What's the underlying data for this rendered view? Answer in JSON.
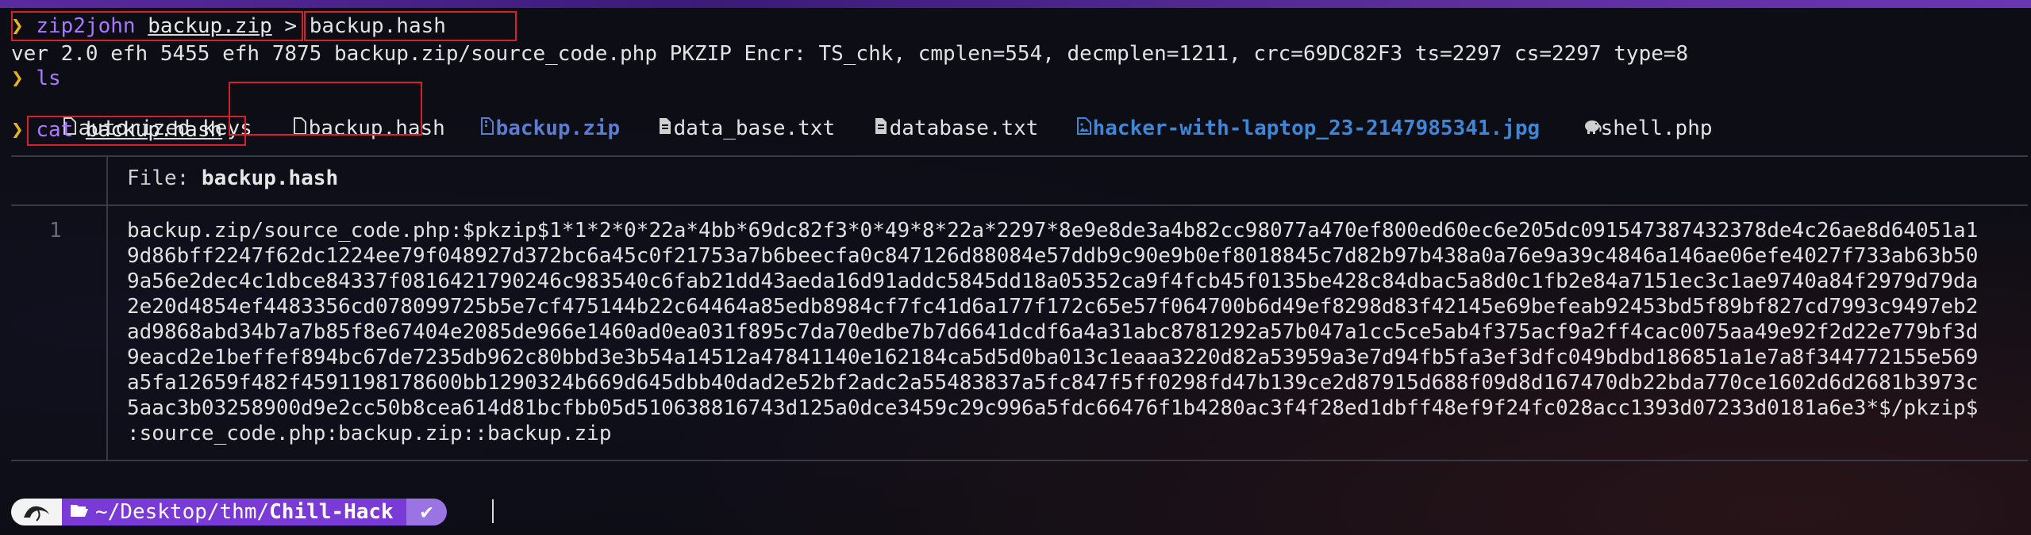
{
  "prompt_symbol": "❯",
  "line1": {
    "cmd": "zip2john",
    "arg": "backup.zip",
    "redirect": " > ",
    "out": "backup.hash"
  },
  "line2": {
    "text": "ver 2.0 efh 5455 efh 7875 backup.zip/source_code.php PKZIP Encr: TS_chk, cmplen=554, decmplen=1211, crc=69DC82F3 ts=2297 cs=2297 type=8"
  },
  "line3": {
    "cmd": "ls"
  },
  "ls_items": [
    {
      "name": "autorized_keys",
      "icon": "file-icon"
    },
    {
      "name": "backup.hash",
      "icon": "file-icon"
    },
    {
      "name": "backup.zip",
      "icon": "zip-icon"
    },
    {
      "name": "data_base.txt",
      "icon": "text-file-icon"
    },
    {
      "name": "database.txt",
      "icon": "text-file-icon"
    },
    {
      "name": "hacker-with-laptop_23-2147985341.jpg",
      "icon": "image-icon"
    },
    {
      "name": "shell.php",
      "icon": "php-elephant-icon"
    }
  ],
  "line4": {
    "cmd": "cat",
    "arg": "backup.hash"
  },
  "bat": {
    "file_label": "File: ",
    "file_name": "backup.hash",
    "line_number": "1",
    "lines": [
      "backup.zip/source_code.php:$pkzip$1*1*2*0*22a*4bb*69dc82f3*0*49*8*22a*2297*8e9e8de3a4b82cc98077a470ef800ed60ec6e205dc091547387432378de4c26ae8d64051a1",
      "9d86bff2247f62dc1224ee79f048927d372bc6a45c0f21753a7b6beecfa0c847126d88084e57ddb9c90e9b0ef8018845c7d82b97b438a0a76e9a39c4846a146ae06efe4027f733ab63b50",
      "9a56e2dec4c1dbce84337f0816421790246c983540c6fab21dd43aeda16d91addc5845dd18a05352ca9f4fcb45f0135be428c84dbac5a8d0c1fb2e84a7151ec3c1ae9740a84f2979d79da",
      "2e20d4854ef4483356cd078099725b5e7cf475144b22c64464a85edb8984cf7fc41d6a177f172c65e57f064700b6d49ef8298d83f42145e69befeab92453bd5f89bf827cd7993c9497eb2",
      "ad9868abd34b7a7b85f8e67404e2085de966e1460ad0ea031f895c7da70edbe7b7d6641dcdf6a4a31abc8781292a57b047a1cc5ce5ab4f375acf9a2ff4cac0075aa49e92f2d22e779bf3d",
      "9eacd2e1beffef894bc67de7235db962c80bbd3e3b54a14512a47841140e162184ca5d5d0ba013c1eaaa3220d82a53959a3e7d94fb5fa3ef3dfc049bdbd186851a1e7a8f344772155e569",
      "a5fa12659f482f4591198178600bb1290324b669d645dbb40dad2e52bf2adc2a55483837a5fc847f5ff0298fd47b139ce2d87915d688f09d8d167470db22bda770ce1602d6d2681b3973c",
      "5aac3b03258900d9e2cc50b8cea614d81bcfbb05d510638816743d125a0dce3459c29c996a5fdc66476f1b4280ac3f4f28ed1dbff48ef9f24fc028acc1393d07233d0181a6e3*$/pkzip$",
      ":source_code.php:backup.zip::backup.zip"
    ]
  },
  "statusbar": {
    "path_prefix": "~/Desktop/thm/",
    "path_dir": "Chill-Hack",
    "check": "✔"
  },
  "colors": {
    "accent": "#7a3ad6",
    "prompt": "#e6b322",
    "command": "#a879ff",
    "highlight_box": "#d8202a"
  }
}
